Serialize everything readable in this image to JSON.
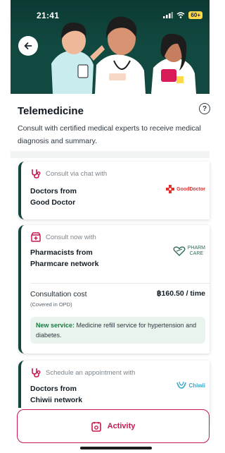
{
  "status_bar": {
    "time": "21:41",
    "battery": "60+"
  },
  "header": {
    "title": "Telemedicine",
    "description": "Consult with certified medical experts to receive medical diagnosis and summary."
  },
  "cards": [
    {
      "label": "Consult via chat with",
      "title_line1": "Doctors from",
      "title_line2": "Good Doctor",
      "partner": "GoodDoctor"
    },
    {
      "label": "Consult now with",
      "title_line1": "Pharmacists from",
      "title_line2": "Pharmcare network",
      "partner_line1": "PHARM",
      "partner_line2": "CARE",
      "cost_label": "Consultation cost",
      "cost_sub": "(Covered in OPD)",
      "cost_value": "฿160.50 / time",
      "notice_strong": "New service:",
      "notice_text": " Medicine refill service for hypertension and diabetes."
    },
    {
      "label": "Schedule an appointment with",
      "title_line1": "Doctors from",
      "title_line2": "Chiwii network",
      "partner": "Chiwii"
    }
  ],
  "bottom": {
    "activity_label": "Activity"
  },
  "colors": {
    "hero_bg": "#11483f",
    "brand_green": "#12463c",
    "accent_red": "#c8184d",
    "notice_bg": "#e9f5ec"
  },
  "icons": [
    "back-arrow-icon",
    "help-icon",
    "stethoscope-icon",
    "pharmacy-icon",
    "activity-icon"
  ]
}
